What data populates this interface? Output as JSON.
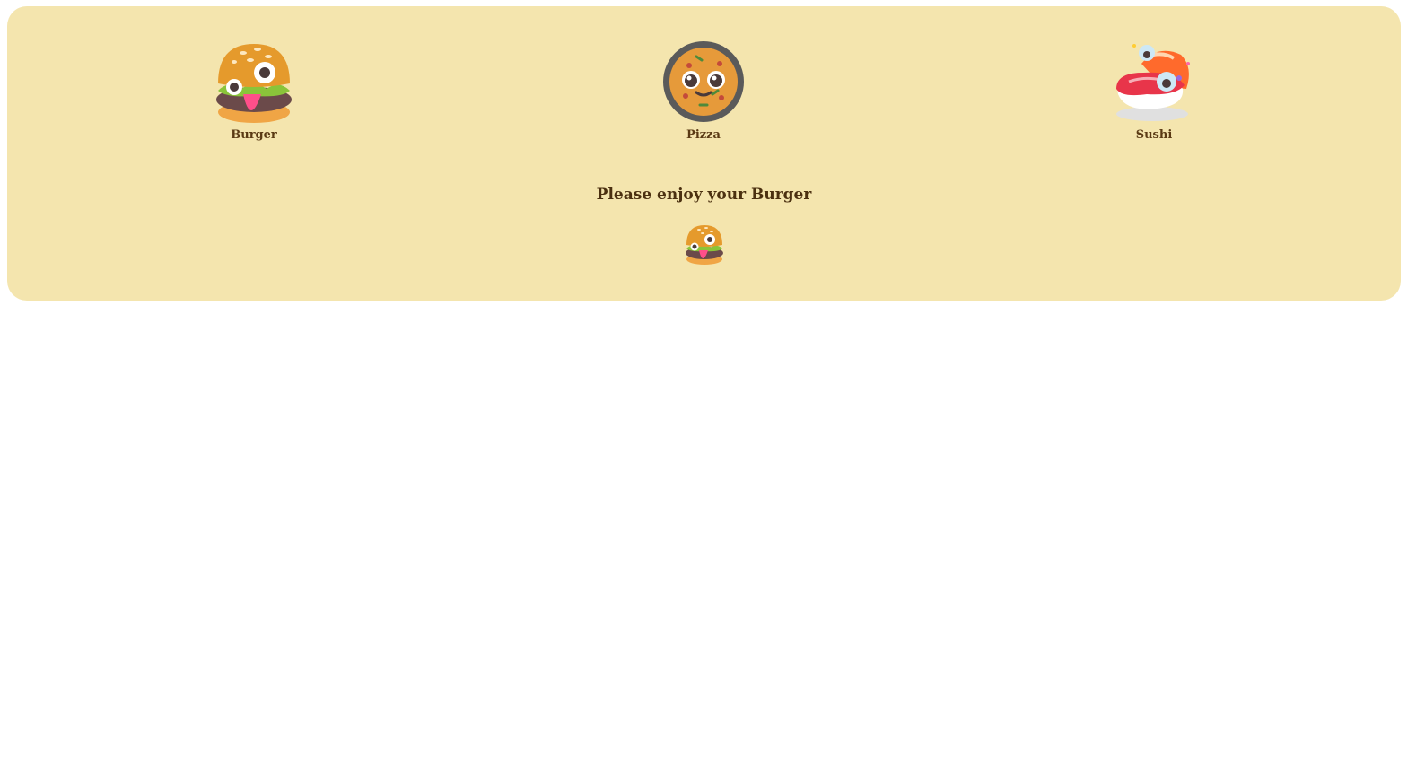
{
  "colors": {
    "panel_background": "#f4e5ae",
    "label_text": "#5a3a14",
    "message_text": "#4b3010"
  },
  "menu": {
    "items": [
      {
        "label": "Burger",
        "icon": "burger-icon"
      },
      {
        "label": "Pizza",
        "icon": "pizza-icon"
      },
      {
        "label": "Sushi",
        "icon": "sushi-icon"
      }
    ]
  },
  "result": {
    "message": "Please enjoy your Burger",
    "icon": "burger-icon"
  }
}
